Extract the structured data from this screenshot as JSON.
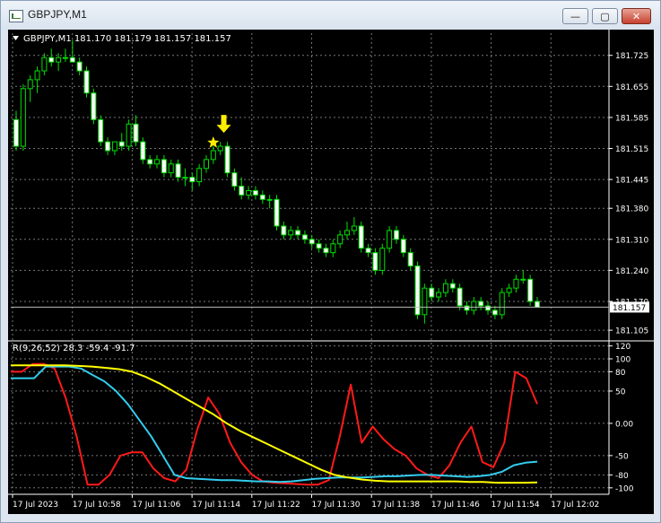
{
  "window": {
    "title": "GBPJPY,M1",
    "minimize_glyph": "—",
    "maximize_glyph": "▢",
    "close_glyph": "✕"
  },
  "chart_data": [
    {
      "type": "candlestick",
      "header": "GBPJPY,M1  181.170 181.179 181.157 181.157",
      "symbol": "GBPJPY",
      "timeframe": "M1",
      "ohlc_readout": [
        181.17,
        181.179,
        181.157,
        181.157
      ],
      "current_price": 181.157,
      "ylim": [
        181.085,
        181.775
      ],
      "y_ticks": [
        181.725,
        181.655,
        181.585,
        181.515,
        181.445,
        181.38,
        181.31,
        181.24,
        181.17,
        181.105
      ],
      "x_ticks": [
        "17 Jul 2023",
        "17 Jul 10:58",
        "17 Jul 11:06",
        "17 Jul 11:14",
        "17 Jul 11:22",
        "17 Jul 11:30",
        "17 Jul 11:38",
        "17 Jul 11:46",
        "17 Jul 11:54",
        "17 Jul 12:02"
      ],
      "candles": [
        [
          181.58,
          181.6,
          181.51,
          181.52
        ],
        [
          181.52,
          181.66,
          181.51,
          181.65
        ],
        [
          181.65,
          181.68,
          181.62,
          181.67
        ],
        [
          181.67,
          181.7,
          181.64,
          181.69
        ],
        [
          181.69,
          181.73,
          181.68,
          181.72
        ],
        [
          181.72,
          181.74,
          181.7,
          181.71
        ],
        [
          181.71,
          181.73,
          181.69,
          181.72
        ],
        [
          181.72,
          181.74,
          181.71,
          181.72
        ],
        [
          181.72,
          181.76,
          181.71,
          181.71
        ],
        [
          181.71,
          181.72,
          181.68,
          181.69
        ],
        [
          181.69,
          181.7,
          181.63,
          181.64
        ],
        [
          181.64,
          181.65,
          181.57,
          181.58
        ],
        [
          181.58,
          181.59,
          181.52,
          181.53
        ],
        [
          181.53,
          181.54,
          181.5,
          181.51
        ],
        [
          181.51,
          181.53,
          181.5,
          181.53
        ],
        [
          181.53,
          181.55,
          181.51,
          181.52
        ],
        [
          181.52,
          181.58,
          181.51,
          181.57
        ],
        [
          181.57,
          181.59,
          181.52,
          181.53
        ],
        [
          181.53,
          181.54,
          181.48,
          181.49
        ],
        [
          181.49,
          181.5,
          181.47,
          181.48
        ],
        [
          181.48,
          181.5,
          181.47,
          181.49
        ],
        [
          181.49,
          181.5,
          181.45,
          181.46
        ],
        [
          181.46,
          181.49,
          181.45,
          181.48
        ],
        [
          181.48,
          181.49,
          181.44,
          181.45
        ],
        [
          181.45,
          181.47,
          181.43,
          181.45
        ],
        [
          181.45,
          181.46,
          181.42,
          181.44
        ],
        [
          181.44,
          181.48,
          181.43,
          181.47
        ],
        [
          181.47,
          181.5,
          181.46,
          181.49
        ],
        [
          181.49,
          181.52,
          181.48,
          181.51
        ],
        [
          181.51,
          181.53,
          181.5,
          181.52
        ],
        [
          181.52,
          181.53,
          181.45,
          181.46
        ],
        [
          181.46,
          181.47,
          181.42,
          181.43
        ],
        [
          181.43,
          181.45,
          181.4,
          181.41
        ],
        [
          181.41,
          181.43,
          181.4,
          181.42
        ],
        [
          181.42,
          181.43,
          181.4,
          181.41
        ],
        [
          181.41,
          181.42,
          181.39,
          181.4
        ],
        [
          181.4,
          181.41,
          181.38,
          181.4
        ],
        [
          181.4,
          181.41,
          181.33,
          181.34
        ],
        [
          181.34,
          181.35,
          181.31,
          181.32
        ],
        [
          181.32,
          181.34,
          181.31,
          181.33
        ],
        [
          181.33,
          181.34,
          181.31,
          181.32
        ],
        [
          181.32,
          181.33,
          181.3,
          181.31
        ],
        [
          181.31,
          181.32,
          181.29,
          181.3
        ],
        [
          181.3,
          181.31,
          181.28,
          181.29
        ],
        [
          181.29,
          181.3,
          181.27,
          181.28
        ],
        [
          181.28,
          181.31,
          181.27,
          181.3
        ],
        [
          181.3,
          181.33,
          181.29,
          181.32
        ],
        [
          181.32,
          181.35,
          181.31,
          181.33
        ],
        [
          181.33,
          181.36,
          181.32,
          181.34
        ],
        [
          181.34,
          181.35,
          181.28,
          181.29
        ],
        [
          181.29,
          181.3,
          181.27,
          181.28
        ],
        [
          181.28,
          181.29,
          181.23,
          181.24
        ],
        [
          181.24,
          181.3,
          181.23,
          181.29
        ],
        [
          181.29,
          181.34,
          181.28,
          181.33
        ],
        [
          181.33,
          181.34,
          181.3,
          181.31
        ],
        [
          181.31,
          181.32,
          181.27,
          181.28
        ],
        [
          181.28,
          181.29,
          181.24,
          181.25
        ],
        [
          181.25,
          181.26,
          181.13,
          181.14
        ],
        [
          181.14,
          181.21,
          181.12,
          181.2
        ],
        [
          181.2,
          181.21,
          181.17,
          181.18
        ],
        [
          181.18,
          181.2,
          181.17,
          181.19
        ],
        [
          181.19,
          181.22,
          181.18,
          181.21
        ],
        [
          181.21,
          181.22,
          181.19,
          181.2
        ],
        [
          181.2,
          181.21,
          181.15,
          181.16
        ],
        [
          181.16,
          181.17,
          181.14,
          181.15
        ],
        [
          181.15,
          181.18,
          181.14,
          181.17
        ],
        [
          181.17,
          181.18,
          181.15,
          181.16
        ],
        [
          181.16,
          181.17,
          181.14,
          181.15
        ],
        [
          181.15,
          181.16,
          181.13,
          181.14
        ],
        [
          181.14,
          181.2,
          181.13,
          181.19
        ],
        [
          181.19,
          181.21,
          181.18,
          181.2
        ],
        [
          181.2,
          181.23,
          181.19,
          181.22
        ],
        [
          181.22,
          181.24,
          181.21,
          181.22
        ],
        [
          181.22,
          181.23,
          181.16,
          181.17
        ],
        [
          181.17,
          181.18,
          181.157,
          181.157
        ]
      ],
      "signal": {
        "star_candle": 28,
        "arrow_candle": 30
      }
    },
    {
      "type": "line",
      "indicator_label": "R(9,26,52) 28.3 -59.4 -91.7",
      "readout": [
        28.3,
        -59.4,
        -91.7
      ],
      "ylim": [
        -110,
        125
      ],
      "y_ticks": [
        120,
        100,
        80,
        50,
        0.0,
        -50,
        -80,
        -100
      ],
      "series": [
        {
          "color": "#ff1a1a",
          "values": [
            80,
            80,
            92,
            92,
            85,
            40,
            -20,
            -95,
            -95,
            -80,
            -50,
            -45,
            -45,
            -70,
            -85,
            -90,
            -72,
            -10,
            40,
            15,
            -30,
            -60,
            -80,
            -90,
            -92,
            -93,
            -94,
            -95,
            -95,
            -88,
            -20,
            60,
            -30,
            -5,
            -25,
            -40,
            -50,
            -70,
            -80,
            -85,
            -65,
            -30,
            -5,
            -60,
            -68,
            -30,
            80,
            70,
            30
          ]
        },
        {
          "color": "#33ccee",
          "values": [
            70,
            70,
            70,
            88,
            88,
            88,
            85,
            75,
            65,
            50,
            30,
            5,
            -20,
            -50,
            -80,
            -85,
            -86,
            -87,
            -88,
            -88,
            -89,
            -90,
            -90,
            -91,
            -90,
            -88,
            -86,
            -85,
            -84,
            -84,
            -84,
            -83,
            -82,
            -82,
            -81,
            -80,
            -80,
            -81,
            -82,
            -83,
            -82,
            -80,
            -75,
            -65,
            -61,
            -59.4
          ]
        },
        {
          "color": "#ffff00",
          "values": [
            90,
            90,
            90,
            90,
            90,
            89,
            88,
            86,
            84,
            80,
            72,
            62,
            50,
            38,
            26,
            14,
            0,
            -12,
            -22,
            -32,
            -42,
            -52,
            -62,
            -72,
            -80,
            -84,
            -87,
            -89,
            -90,
            -90,
            -90,
            -90,
            -90,
            -90,
            -91,
            -91,
            -92,
            -92,
            -92,
            -91.7
          ]
        }
      ]
    }
  ]
}
